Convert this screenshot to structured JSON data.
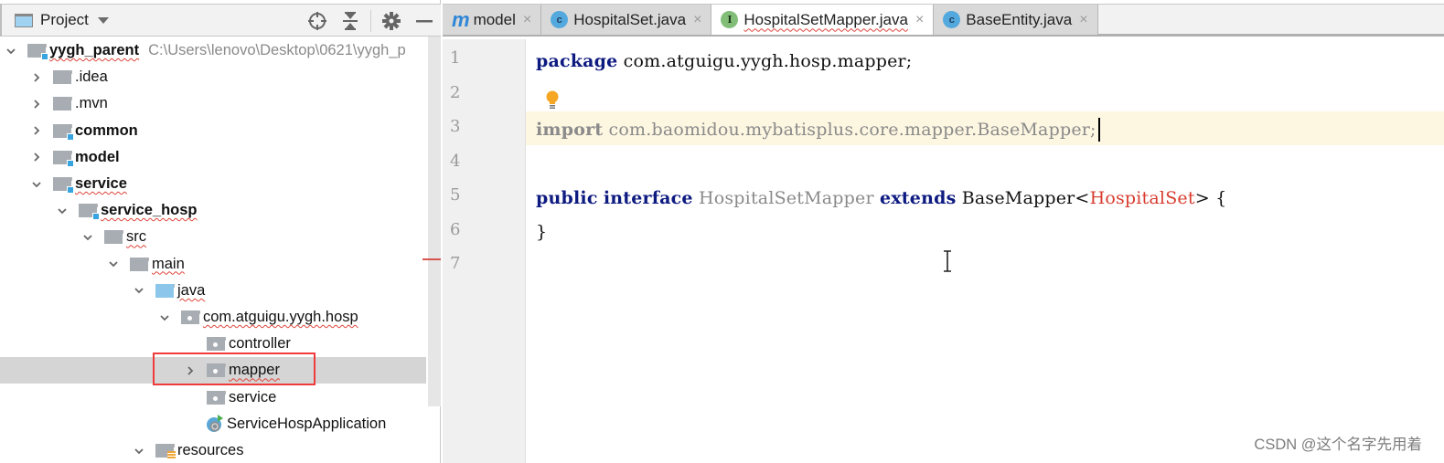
{
  "project_panel": {
    "title": "Project",
    "tools": [
      {
        "name": "locate-icon",
        "glyph": "⊕"
      },
      {
        "name": "collapse-all-icon",
        "glyph": "⇕"
      },
      {
        "name": "settings-gear-icon",
        "glyph": "⚙"
      },
      {
        "name": "minimize-icon",
        "glyph": "—"
      }
    ],
    "tree": [
      {
        "label": "yygh_parent",
        "path_hint": "C:\\Users\\lenovo\\Desktop\\0621\\yygh_p",
        "expanded": true,
        "icon": "module-folder"
      },
      {
        "label": ".idea",
        "expanded": false,
        "icon": "folder"
      },
      {
        "label": ".mvn",
        "expanded": false,
        "icon": "folder"
      },
      {
        "label": "common",
        "expanded": false,
        "icon": "module-folder"
      },
      {
        "label": "model",
        "expanded": false,
        "icon": "module-folder"
      },
      {
        "label": "service",
        "expanded": true,
        "icon": "module-folder"
      },
      {
        "label": "service_hosp",
        "expanded": true,
        "icon": "module-folder"
      },
      {
        "label": "src",
        "expanded": true,
        "icon": "folder"
      },
      {
        "label": "main",
        "expanded": true,
        "icon": "folder"
      },
      {
        "label": "java",
        "expanded": true,
        "icon": "source-folder"
      },
      {
        "label": "com.atguigu.yygh.hosp",
        "expanded": true,
        "icon": "package"
      },
      {
        "label": "controller",
        "icon": "package"
      },
      {
        "label": "mapper",
        "expanded": false,
        "icon": "package",
        "selected": true
      },
      {
        "label": "service",
        "icon": "package"
      },
      {
        "label": "ServiceHospApplication",
        "icon": "spring-boot-class"
      },
      {
        "label": "resources",
        "expanded": true,
        "icon": "resources-folder"
      }
    ]
  },
  "editor": {
    "tabs": [
      {
        "label": "model",
        "icon": "maven-module-icon",
        "icon_letter": "m",
        "active": false
      },
      {
        "label": "HospitalSet.java",
        "icon": "class-icon",
        "icon_letter": "c",
        "active": false
      },
      {
        "label": "HospitalSetMapper.java",
        "icon": "interface-icon",
        "icon_letter": "I",
        "active": true
      },
      {
        "label": "BaseEntity.java",
        "icon": "class-icon",
        "icon_letter": "c",
        "active": false
      }
    ],
    "close_glyph": "×",
    "current_line": 3,
    "line_numbers": [
      "1",
      "2",
      "3",
      "4",
      "5",
      "6",
      "7"
    ],
    "code": {
      "line1": {
        "kw": "package",
        "rest": " com.atguigu.yygh.hosp.mapper;"
      },
      "line3": {
        "kw": "import",
        "rest": " com.baomidou.mybatisplus.core.mapper.BaseMapper;"
      },
      "line5": {
        "kw1": "public",
        "kw2": "interface",
        "name": "HospitalSetMapper",
        "kw3": "extends",
        "base": "BaseMapper<",
        "generic": "HospitalSet",
        "tail": "> {"
      },
      "line6": {
        "text": "}"
      }
    }
  },
  "watermark": "CSDN @这个名字先用着"
}
